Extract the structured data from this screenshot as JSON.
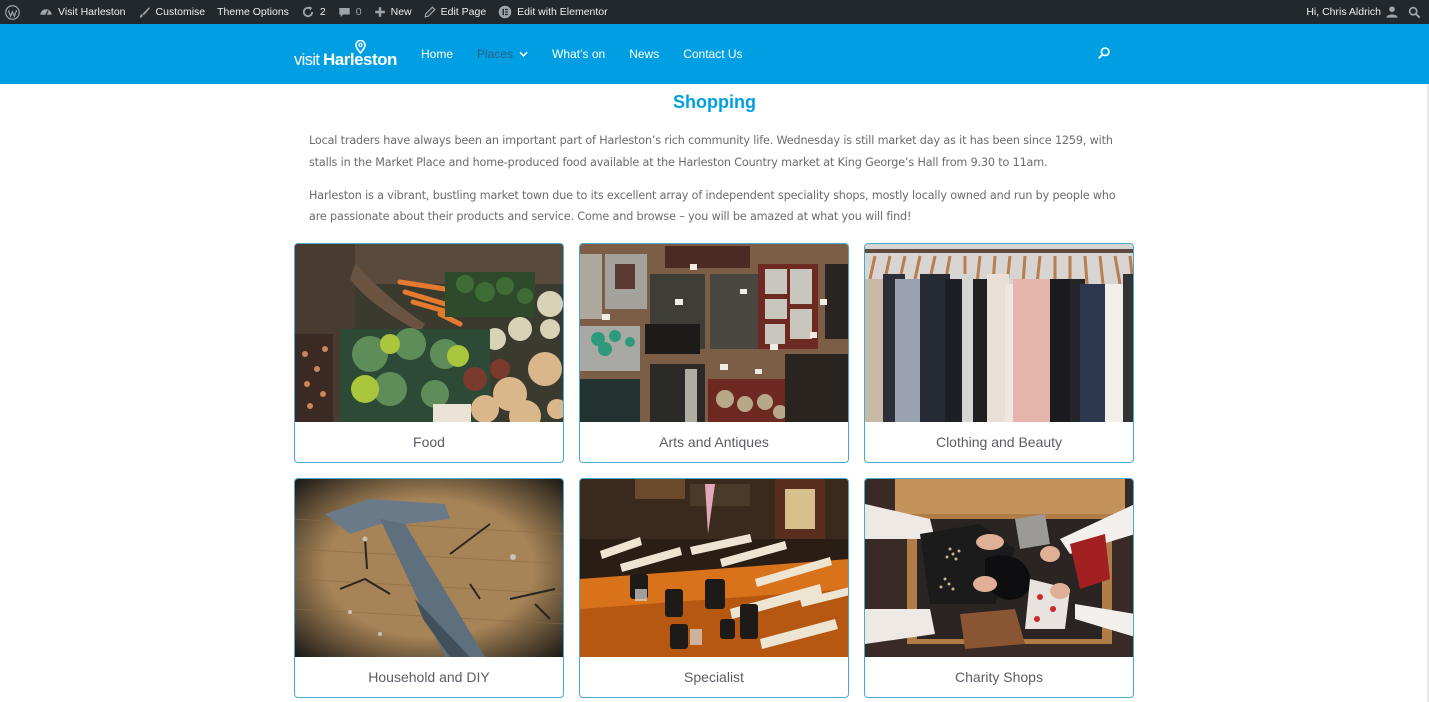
{
  "admin_bar": {
    "site_name": "Visit Harleston",
    "customise": "Customise",
    "theme_options": "Theme Options",
    "updates_count": "2",
    "comments_count": "0",
    "new": "New",
    "edit_page": "Edit Page",
    "edit_elementor": "Edit with Elementor",
    "greeting": "Hi, Chris Aldrich",
    "icons": [
      "wordpress-icon",
      "dashboard-icon",
      "brush-icon",
      "updates-icon",
      "comment-icon",
      "plus-icon",
      "pencil-icon",
      "elementor-icon",
      "user-avatar-icon",
      "search-icon"
    ]
  },
  "header": {
    "logo_light": "visit",
    "logo_bold": "Harleston",
    "nav": [
      {
        "label": "Home",
        "active": false
      },
      {
        "label": "Places",
        "active": true,
        "has_dropdown": true
      },
      {
        "label": "What’s on",
        "active": false
      },
      {
        "label": "News",
        "active": false
      },
      {
        "label": "Contact Us",
        "active": false
      }
    ],
    "brand_color": "#009fe3",
    "active_nav_color": "#2b5f82"
  },
  "page": {
    "title": "Shopping",
    "paragraphs": [
      "Local traders have always been an important part of Harleston’s rich community life. Wednesday is still market day as it has been since 1259, with stalls in the Market Place and home-produced food available at the Harleston Country market at King George’s Hall from 9.30 to 11am.",
      "Harleston is a vibrant, bustling market town due to its excellent array of independent speciality shops, mostly locally owned and run by people who are passionate about their products and service. Come and browse – you will be amazed at what you will find!"
    ],
    "categories": [
      {
        "label": "Food",
        "image": "vegetable-market-stall"
      },
      {
        "label": "Arts and Antiques",
        "image": "antique-jewellery-display"
      },
      {
        "label": "Clothing and Beauty",
        "image": "clothes-rail"
      },
      {
        "label": "Household and DIY",
        "image": "hammer-and-nails"
      },
      {
        "label": "Specialist",
        "image": "quill-pens-and-inkwells"
      },
      {
        "label": "Charity Shops",
        "image": "chest-of-clothes"
      }
    ]
  }
}
